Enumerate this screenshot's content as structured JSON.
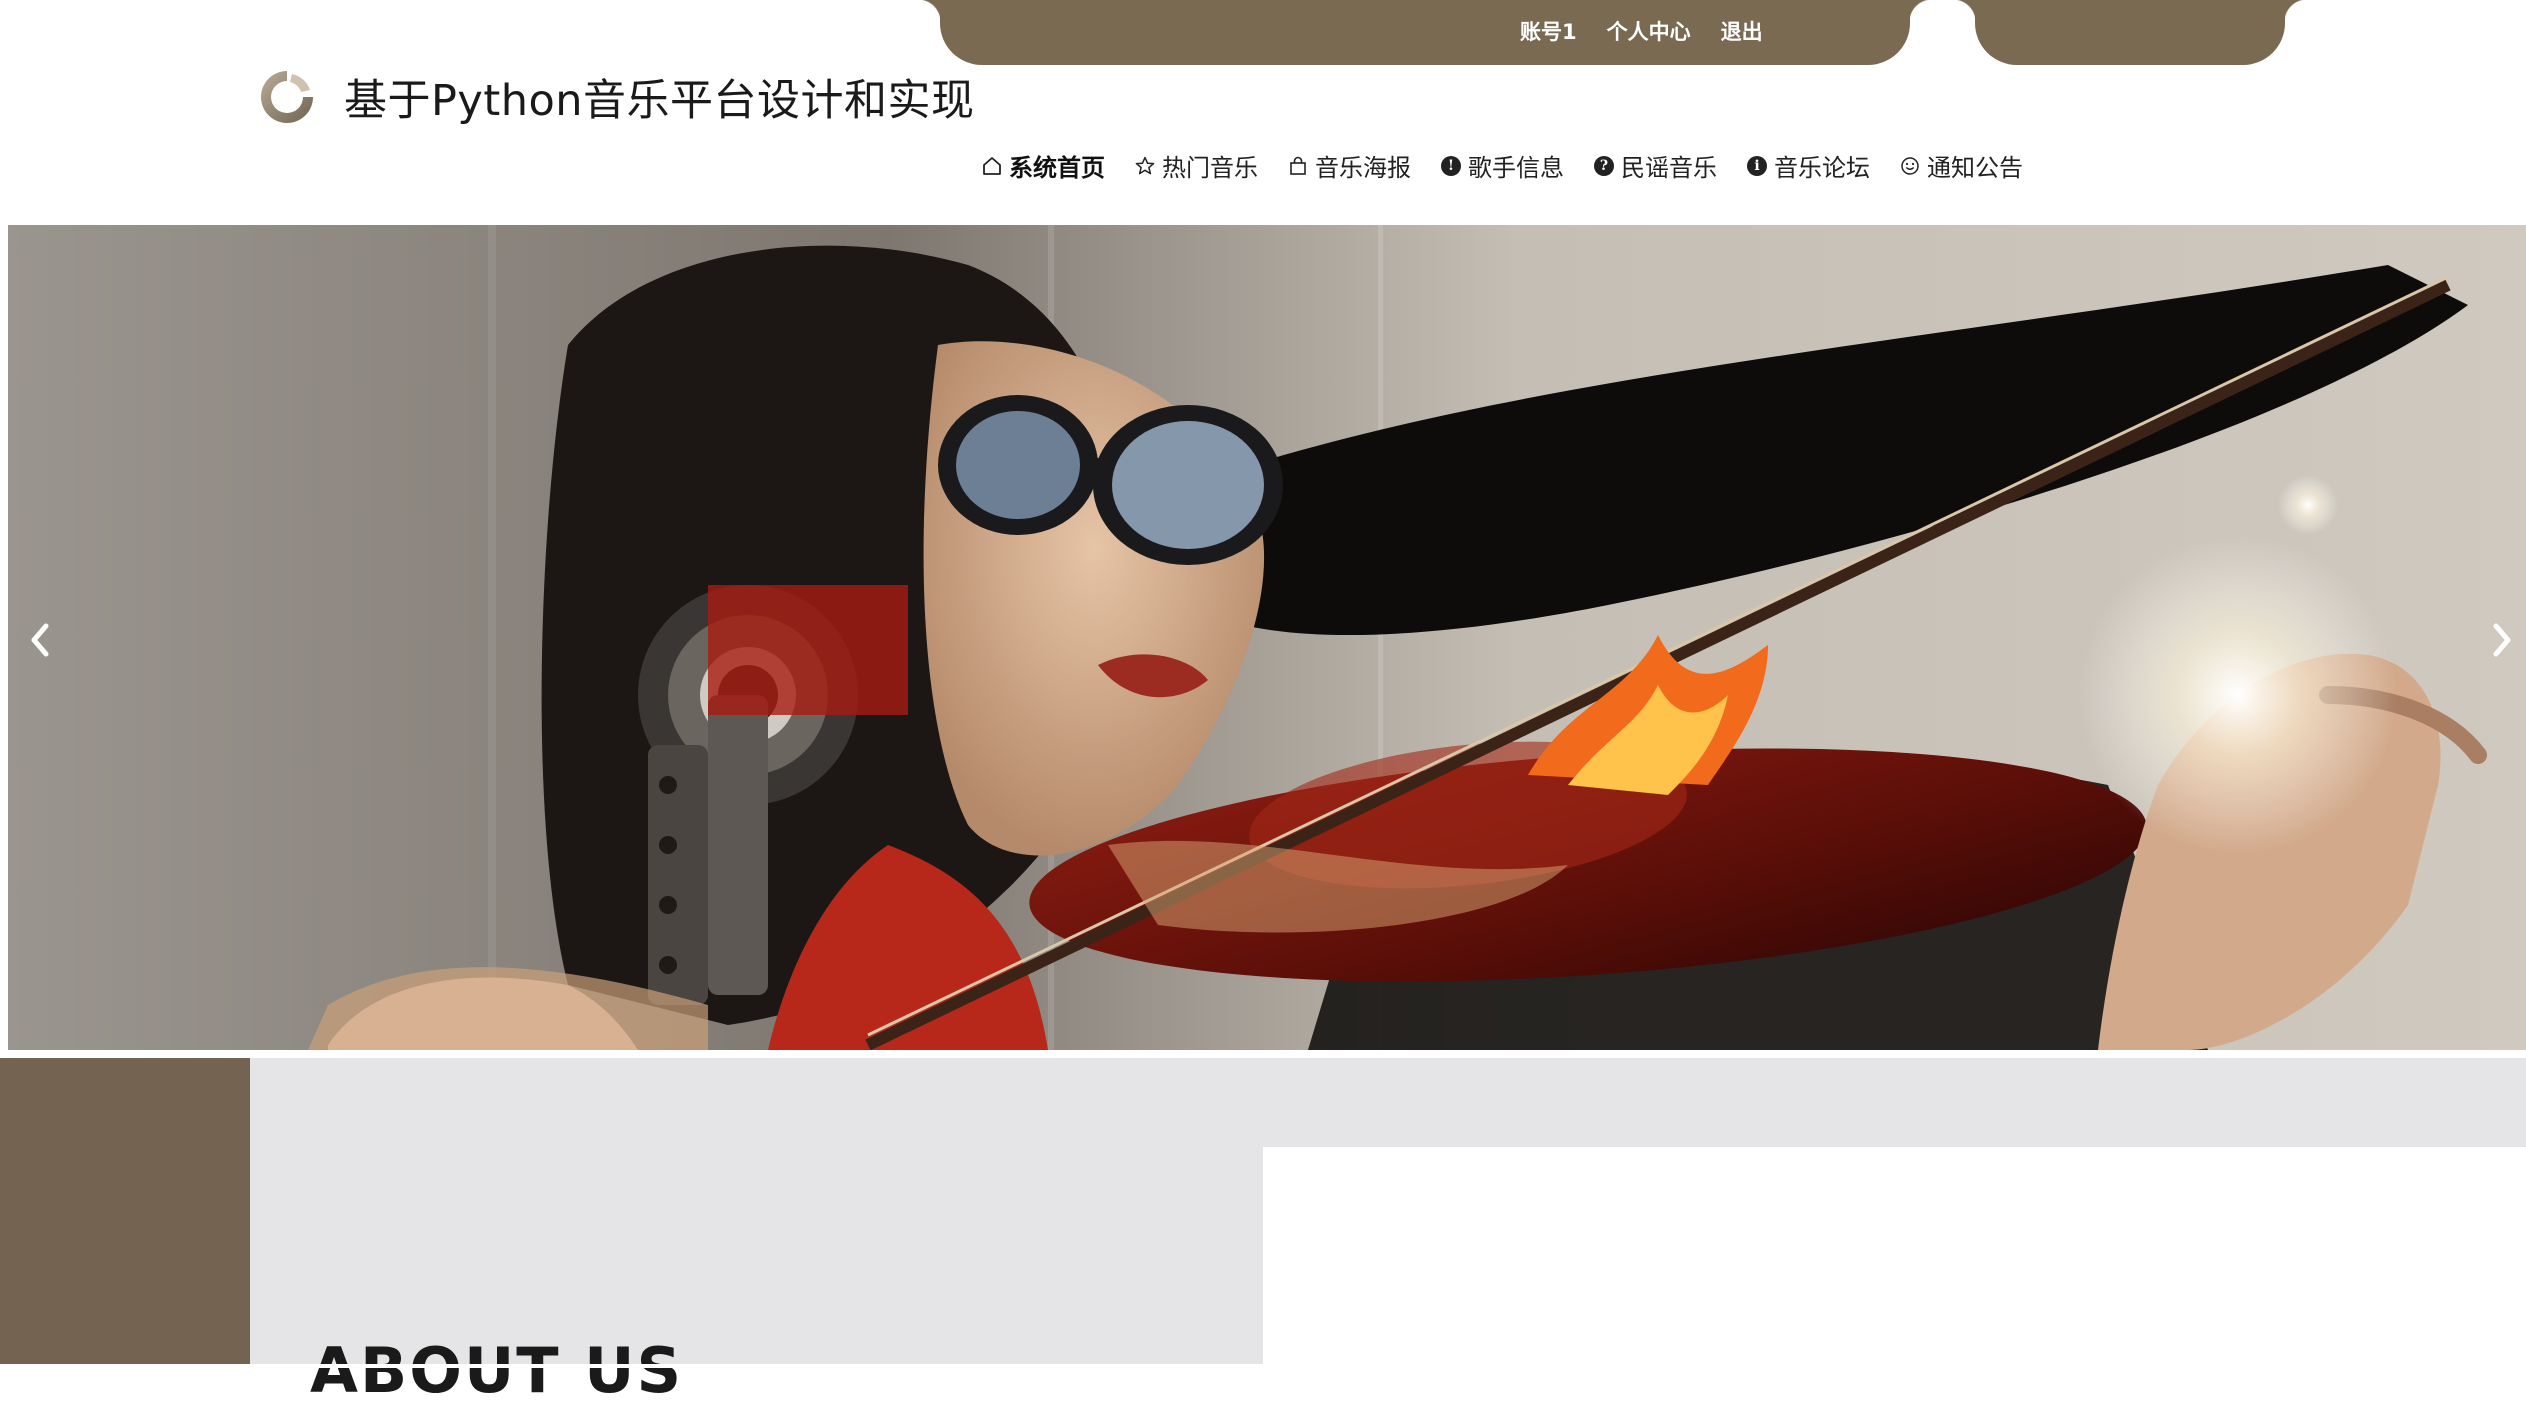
{
  "topbar": {
    "account": "账号1",
    "profile": "个人中心",
    "logout": "退出"
  },
  "brand": {
    "title": "基于Python音乐平台设计和实现",
    "logo_icon": "play-circle-logo"
  },
  "nav": {
    "items": [
      {
        "label": "系统首页",
        "icon": "home-icon",
        "active": true
      },
      {
        "label": "热门音乐",
        "icon": "star-icon",
        "active": false
      },
      {
        "label": "音乐海报",
        "icon": "bag-icon",
        "active": false
      },
      {
        "label": "歌手信息",
        "icon": "exclamation-circle-icon",
        "active": false
      },
      {
        "label": "民谣音乐",
        "icon": "question-circle-icon",
        "active": false
      },
      {
        "label": "音乐论坛",
        "icon": "info-circle-icon",
        "active": false
      },
      {
        "label": "通知公告",
        "icon": "smile-icon",
        "active": false
      }
    ]
  },
  "banner": {
    "prev_icon": "chevron-left-icon",
    "next_icon": "chevron-right-icon"
  },
  "about": {
    "title": "ABOUT US"
  },
  "colors": {
    "accent": "#7a6a52",
    "strip": "#736350",
    "section_bg": "#e5e4e6"
  }
}
